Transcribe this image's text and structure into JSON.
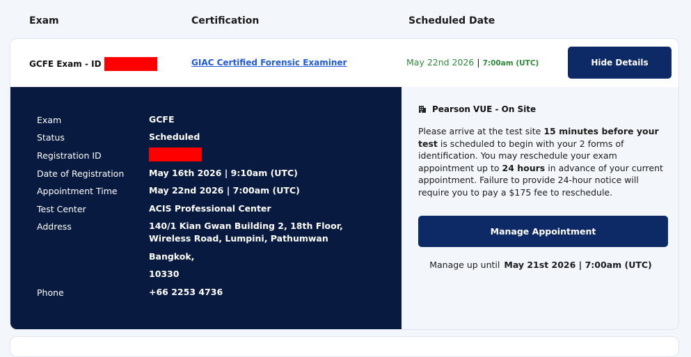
{
  "columns": {
    "exam": "Exam",
    "certification": "Certification",
    "scheduled_date": "Scheduled Date"
  },
  "exam_row": {
    "exam_id_label": "GCFE Exam - ID",
    "certification_link": "GIAC Certified Forensic Examiner",
    "scheduled_date": "May 22nd 2026",
    "separator": "|",
    "scheduled_time": "7:00am (UTC)",
    "hide_details_label": "Hide Details"
  },
  "details": {
    "labels": {
      "exam": "Exam",
      "status": "Status",
      "registration_id": "Registration ID",
      "date_of_registration": "Date of Registration",
      "appointment_time": "Appointment Time",
      "test_center": "Test Center",
      "address": "Address",
      "phone": "Phone"
    },
    "values": {
      "exam": "GCFE",
      "status": "Scheduled",
      "date_of_registration": "May 16th 2026 | 9:10am (UTC)",
      "appointment_time": "May 22nd 2026 | 7:00am (UTC)",
      "test_center": "ACIS Professional Center",
      "address_line1": "140/1 Kian Gwan Building 2, 18th Floor, Wireless Road, Lumpini, Pathumwan",
      "address_city": "Bangkok,",
      "address_postal": "10330",
      "phone": "+66 2253 4736"
    }
  },
  "pearson": {
    "title": "Pearson VUE - On Site",
    "icon": "building-icon",
    "text_1": "Please arrive at the test site ",
    "text_bold_1": "15 minutes before your test",
    "text_2": " is scheduled to begin with your 2 forms of identification. You may reschedule your exam appointment up to ",
    "text_bold_2": "24 hours",
    "text_3": " in advance of your current appointment. Failure to provide 24-hour notice will require you to pay a $175 fee to reschedule.",
    "manage_button_label": "Manage Appointment",
    "manage_until_label": "Manage up until",
    "manage_until_value": "May 21st 2026 | 7:00am (UTC)"
  },
  "colors": {
    "navy_button": "#0d2a66",
    "details_panel": "#081a40",
    "link_blue": "#1f5bd6",
    "scheduled_green": "#2e8b3a",
    "redaction": "#ff0000"
  }
}
